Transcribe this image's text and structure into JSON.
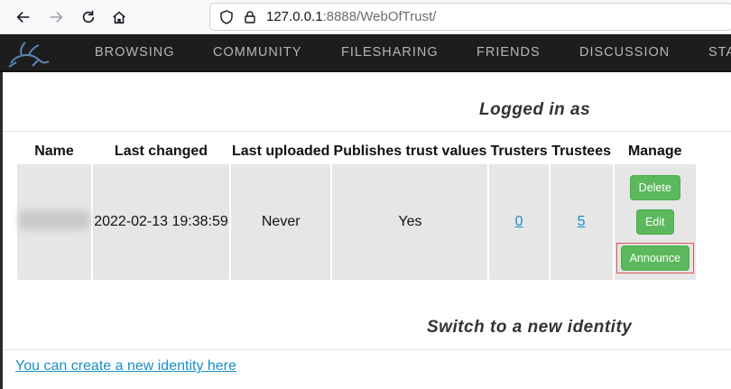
{
  "browser": {
    "url_host": "127.0.0.1",
    "url_rest": ":8888/WebOfTrust/",
    "icons": [
      "back-arrow-icon",
      "forward-arrow-icon",
      "reload-icon",
      "home-icon",
      "shield-icon",
      "lock-icon"
    ]
  },
  "nav": {
    "items": [
      {
        "label": "BROWSING"
      },
      {
        "label": "COMMUNITY"
      },
      {
        "label": "FILESHARING"
      },
      {
        "label": "FRIENDS"
      },
      {
        "label": "DISCUSSION"
      },
      {
        "label": "STA"
      }
    ]
  },
  "main": {
    "logged_in_heading": "Logged in as",
    "table": {
      "headers": [
        "Name",
        "Last changed",
        "Last uploaded",
        "Publishes trust values",
        "Trusters",
        "Trustees",
        "Manage"
      ],
      "row": {
        "last_changed": "2022-02-13 19:38:59",
        "last_uploaded": "Never",
        "publishes": "Yes",
        "trusters": "0",
        "trustees": "5"
      },
      "actions": {
        "delete": "Delete",
        "edit": "Edit",
        "announce": "Announce"
      }
    },
    "switch_heading": "Switch to a new identity",
    "create_link": "You can create a new identity here"
  },
  "colors": {
    "button_green": "#5cb85c",
    "link_blue": "#1a8fc7",
    "nav_bg": "#1d1d1d",
    "highlight_red": "#e25555"
  }
}
